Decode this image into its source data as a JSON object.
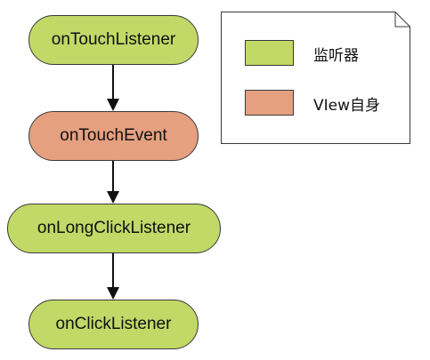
{
  "colors": {
    "listener": "#c2d867",
    "view": "#e5a080",
    "border": "#3a3a3a",
    "arrow": "#111111"
  },
  "flow": {
    "nodes": [
      {
        "label": "onTouchListener",
        "kind": "listener"
      },
      {
        "label": "onTouchEvent",
        "kind": "view"
      },
      {
        "label": "onLongClickListener",
        "kind": "listener"
      },
      {
        "label": "onClickListener",
        "kind": "listener"
      }
    ]
  },
  "legend": {
    "items": [
      {
        "label": "监听器",
        "kind": "listener"
      },
      {
        "label": "VIew自身",
        "kind": "view"
      }
    ]
  }
}
